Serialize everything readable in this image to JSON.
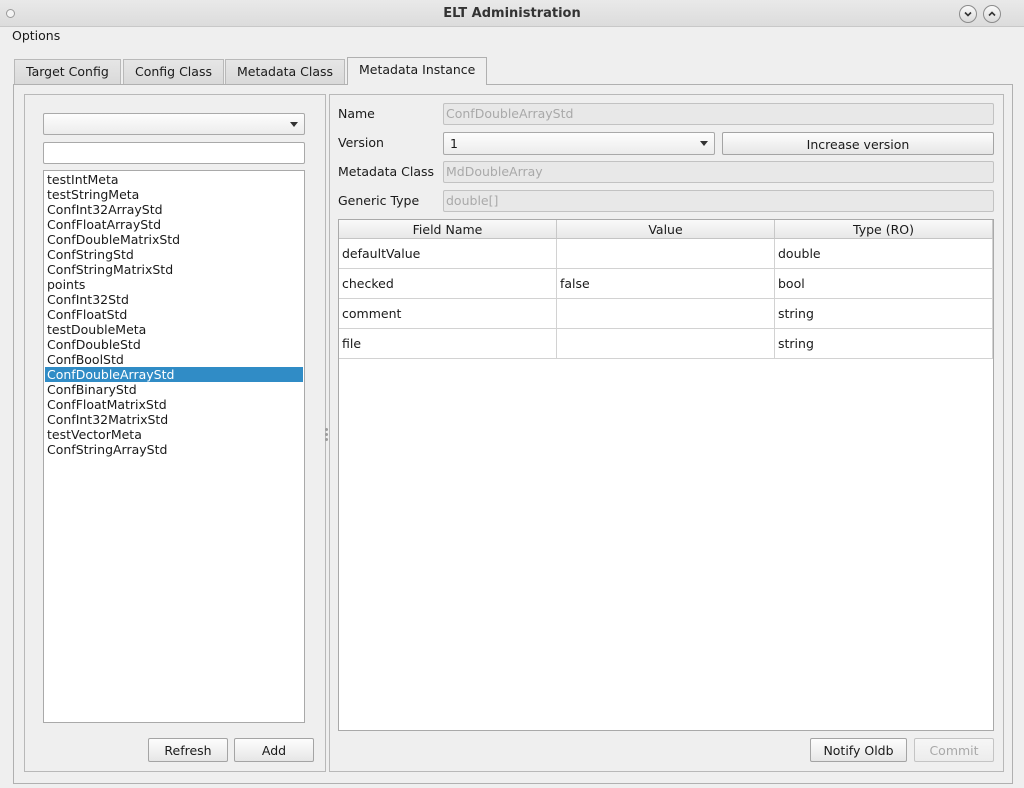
{
  "window": {
    "title": "ELT Administration",
    "icons": [
      "window-menu-icon",
      "minimize-icon",
      "maximize-icon"
    ]
  },
  "menu": {
    "options": "Options"
  },
  "tabs": [
    {
      "label": "Target Config",
      "active": false
    },
    {
      "label": "Config Class",
      "active": false
    },
    {
      "label": "Metadata Class",
      "active": false
    },
    {
      "label": "Metadata Instance",
      "active": true
    }
  ],
  "left": {
    "combo_value": "",
    "filter_value": "",
    "items": [
      "testIntMeta",
      "testStringMeta",
      "ConfInt32ArrayStd",
      "ConfFloatArrayStd",
      "ConfDoubleMatrixStd",
      "ConfStringStd",
      "ConfStringMatrixStd",
      "points",
      "ConfInt32Std",
      "ConfFloatStd",
      "testDoubleMeta",
      "ConfDoubleStd",
      "ConfBoolStd",
      "ConfDoubleArrayStd",
      "ConfBinaryStd",
      "ConfFloatMatrixStd",
      "ConfInt32MatrixStd",
      "testVectorMeta",
      "ConfStringArrayStd"
    ],
    "selected_index": 13,
    "refresh_label": "Refresh",
    "add_label": "Add"
  },
  "right": {
    "name_label": "Name",
    "name_value": "ConfDoubleArrayStd",
    "version_label": "Version",
    "version_value": "1",
    "increase_version_label": "Increase version",
    "metadata_class_label": "Metadata Class",
    "metadata_class_value": "MdDoubleArray",
    "generic_type_label": "Generic Type",
    "generic_type_value": "double[]",
    "table": {
      "headers": [
        "Field Name",
        "Value",
        "Type (RO)"
      ],
      "rows": [
        [
          "defaultValue",
          "",
          "double"
        ],
        [
          "checked",
          "false",
          "bool"
        ],
        [
          "comment",
          "",
          "string"
        ],
        [
          "file",
          "",
          "string"
        ]
      ]
    },
    "notify_label": "Notify Oldb",
    "commit_label": "Commit"
  },
  "colors": {
    "selection": "#308cc6",
    "window_bg": "#efefef"
  }
}
